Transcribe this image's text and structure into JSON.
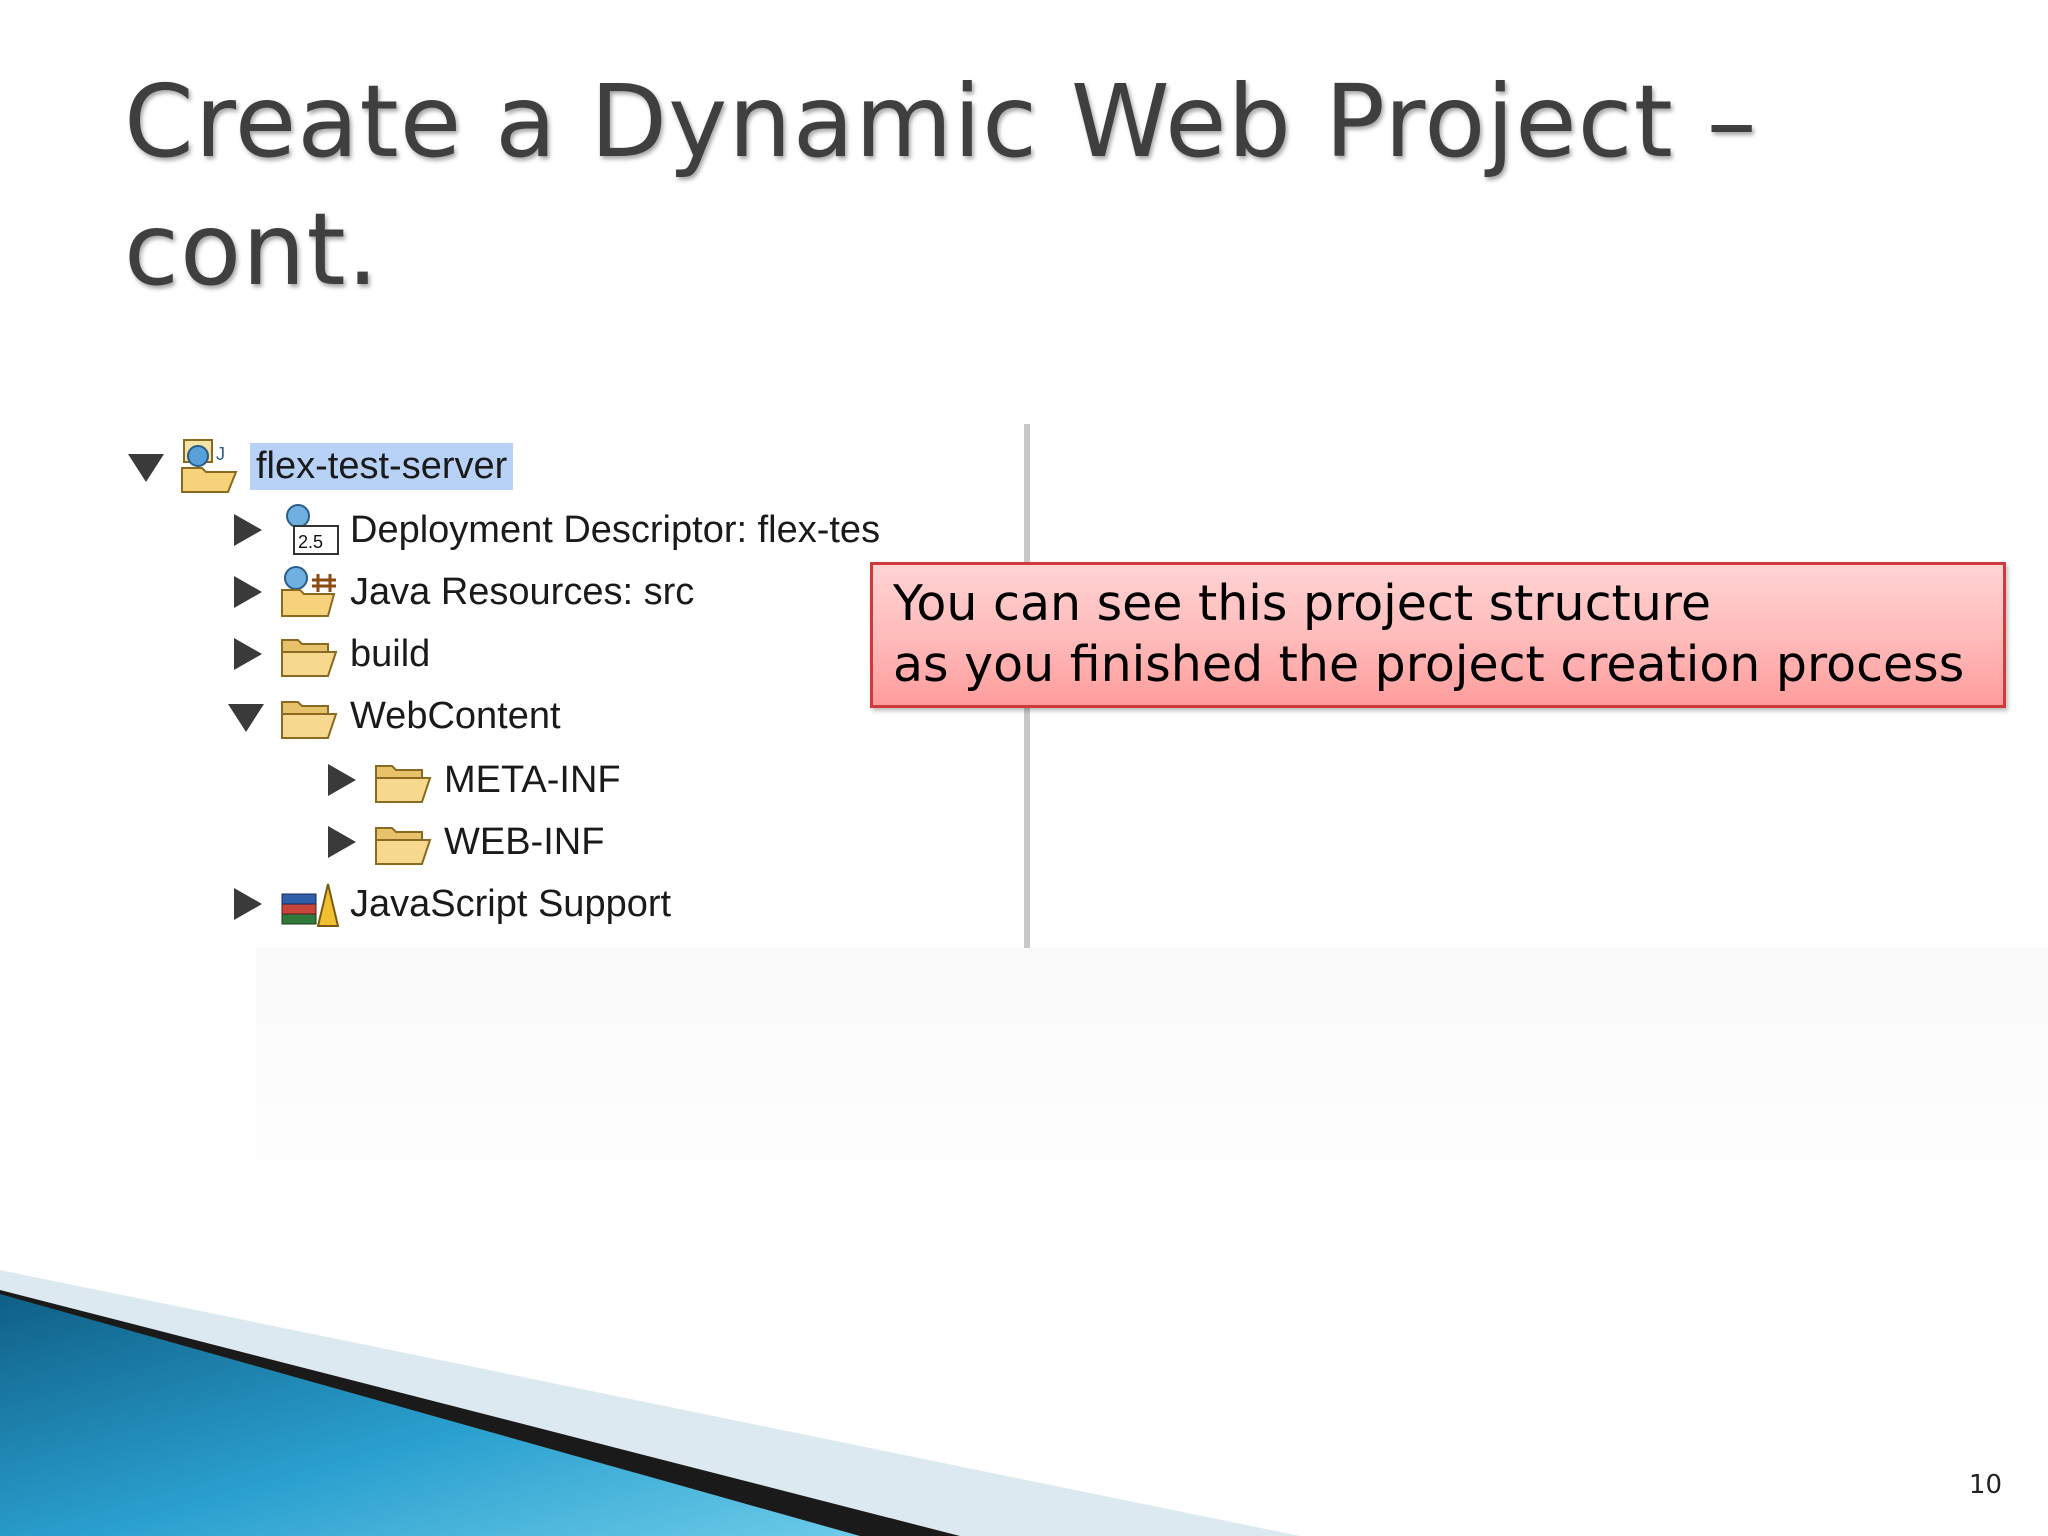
{
  "slide": {
    "title_line1": "Create a Dynamic Web Project –",
    "title_line2": "cont.",
    "page_number": "10"
  },
  "tree": {
    "items": [
      {
        "label": "flex-test-server",
        "icon": "web-project-icon",
        "state": "expanded",
        "selected": true
      },
      {
        "label": "Deployment Descriptor: flex-tes",
        "icon": "deployment-descriptor-icon",
        "badge": "2.5",
        "state": "collapsed"
      },
      {
        "label": "Java Resources: src",
        "icon": "java-resources-icon",
        "state": "collapsed"
      },
      {
        "label": "build",
        "icon": "folder-icon",
        "state": "collapsed"
      },
      {
        "label": "WebContent",
        "icon": "folder-icon",
        "state": "expanded"
      },
      {
        "label": "META-INF",
        "icon": "folder-icon",
        "state": "collapsed"
      },
      {
        "label": "WEB-INF",
        "icon": "folder-icon",
        "state": "collapsed"
      },
      {
        "label": "JavaScript Support",
        "icon": "javascript-library-icon",
        "state": "collapsed"
      }
    ]
  },
  "callout": {
    "line1": "You can see this project structure",
    "line2": "as you finished the project creation process"
  },
  "colors": {
    "title": "#3f3f3f",
    "selection": "#b8d2f7",
    "callout_border": "#d13a3a",
    "callout_fill": "#ffb9b9",
    "swoosh_blue": "#1e7ea6"
  }
}
